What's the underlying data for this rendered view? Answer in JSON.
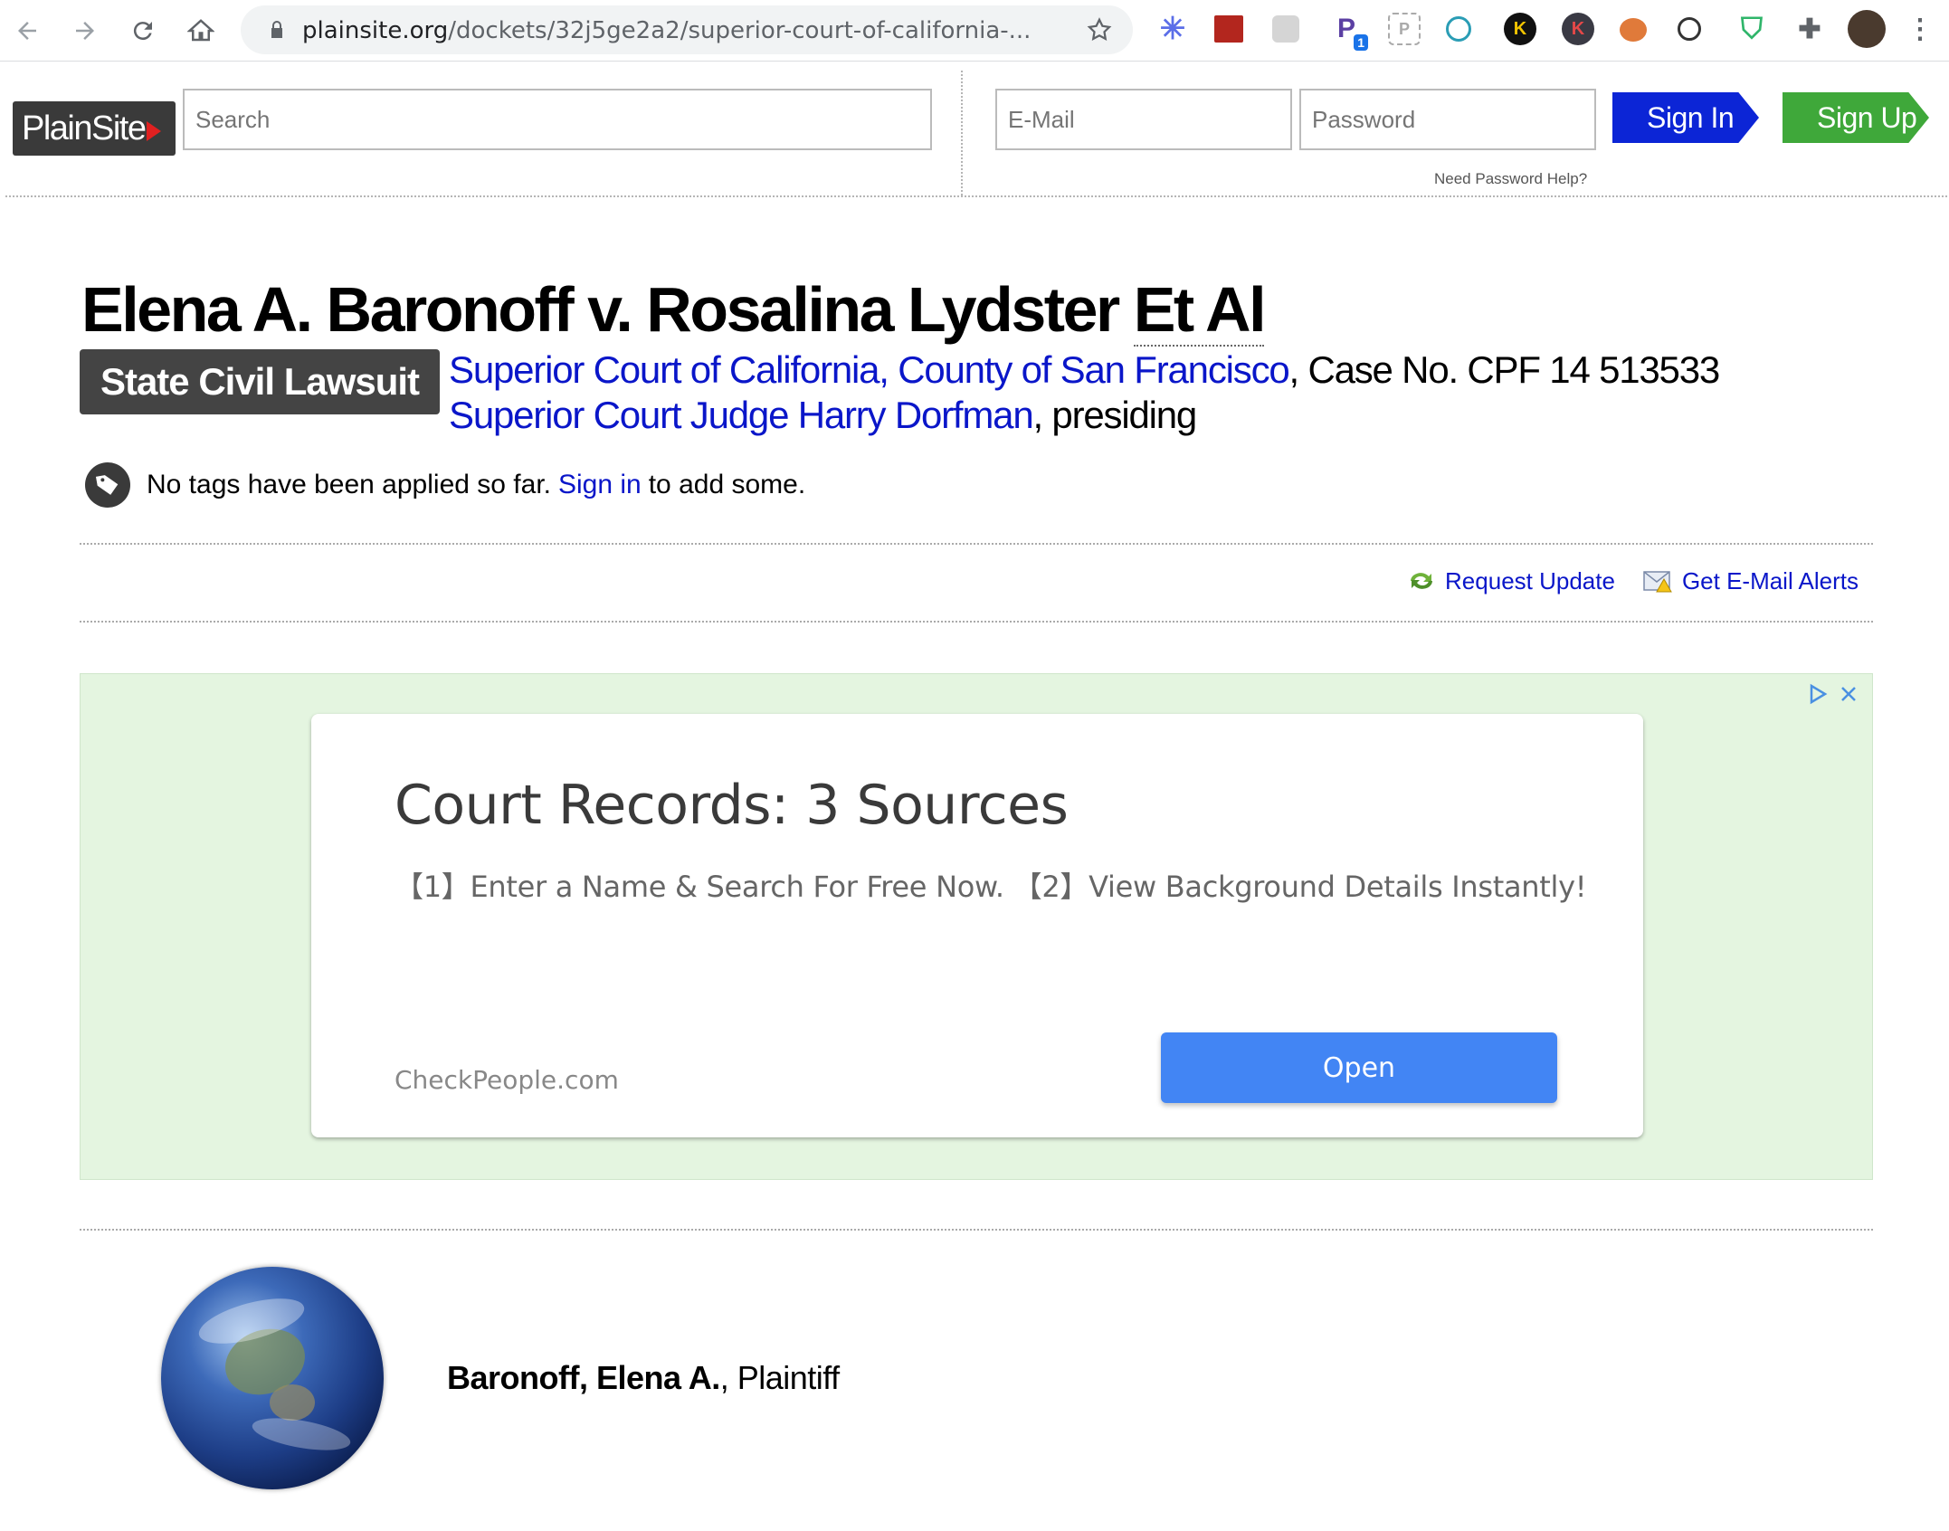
{
  "browser": {
    "url_host": "plainsite.org",
    "url_path": "/dockets/32j5ge2a2/superior-court-of-california-...",
    "extension_badge": "1"
  },
  "header": {
    "logo_text": "PlainSite",
    "search_placeholder": "Search",
    "email_placeholder": "E-Mail",
    "password_placeholder": "Password",
    "sign_in_label": "Sign In",
    "sign_up_label": "Sign Up",
    "password_help": "Need Password Help?"
  },
  "case": {
    "title_main": "Elena A. Baronoff v. Rosalina Lydster ",
    "title_abbr": "Et Al",
    "type_badge": "State Civil Lawsuit",
    "court_link": "Superior Court of California, County of San Francisco",
    "case_number_text": ", Case No. CPF 14 513533",
    "judge_link": "Superior Court Judge Harry Dorfman",
    "judge_suffix": ", presiding"
  },
  "tags": {
    "text_before": "No tags have been applied so far.",
    "sign_in_link": "Sign in",
    "text_after": "to add some."
  },
  "actions": {
    "request_update": "Request Update",
    "email_alerts": "Get E-Mail Alerts"
  },
  "ad": {
    "title": "Court Records: 3 Sources",
    "subtitle": "【1】Enter a Name & Search For Free Now. 【2】View Background Details Instantly!",
    "domain": "CheckPeople.com",
    "button": "Open"
  },
  "party": {
    "name": "Baronoff, Elena A.",
    "role": ", Plaintiff"
  },
  "colors": {
    "link": "#0a16c9",
    "sign_in": "#0c25d6",
    "sign_up": "#3fa83a",
    "ad_background": "#e4f5e0",
    "ad_button": "#4285f4"
  }
}
